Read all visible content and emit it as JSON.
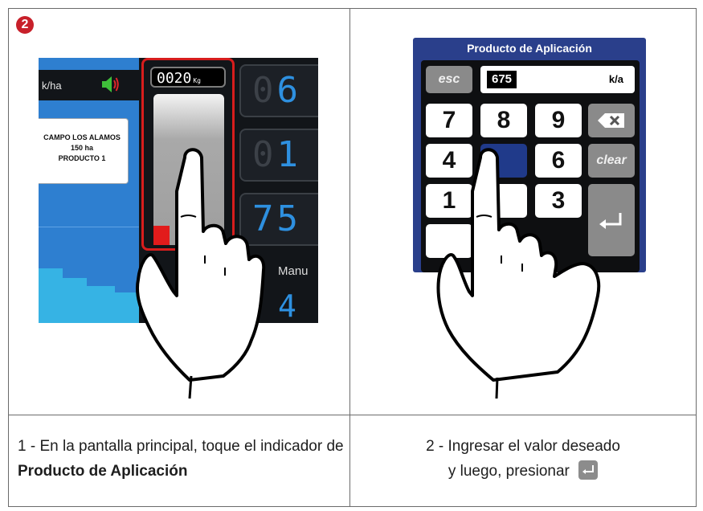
{
  "step_number": "2",
  "left_screen": {
    "rate_unit": "k/ha",
    "gauge_digits": "0020",
    "gauge_unit": "Kg",
    "field_card": {
      "line1": "CAMPO LOS ALAMOS",
      "line2": "150 ha",
      "line3": "PRODUCTO 1"
    },
    "digit_rows": [
      {
        "dim": "0",
        "lit": "6"
      },
      {
        "dim": "0",
        "lit": "1"
      },
      {
        "dim": "",
        "lit": "75"
      }
    ],
    "mode_label": "Manu",
    "bottom_digit": "4",
    "gauge_level_percent": 10,
    "colors": {
      "highlight": "#d71d1d",
      "digits": "#2e90e0",
      "background": "#121519"
    }
  },
  "keypad_popup": {
    "title": "Producto de Aplicación",
    "esc_label": "esc",
    "input_value": "675",
    "input_unit": "k/a",
    "keys": [
      "7",
      "8",
      "9",
      "4",
      "6",
      "1",
      "3"
    ],
    "clear_label": "clear",
    "backspace_icon": "backspace-icon",
    "enter_icon": "enter-icon",
    "colors": {
      "header": "#2a3f8b",
      "key": "#ffffff",
      "function_key": "#8a8a8a"
    }
  },
  "captions": {
    "left_prefix": "1 - En la pantalla principal, toque el indicador de ",
    "left_bold": "Producto de Aplicación",
    "right_line1": "2 - Ingresar el valor deseado",
    "right_line2": "y luego, presionar"
  }
}
